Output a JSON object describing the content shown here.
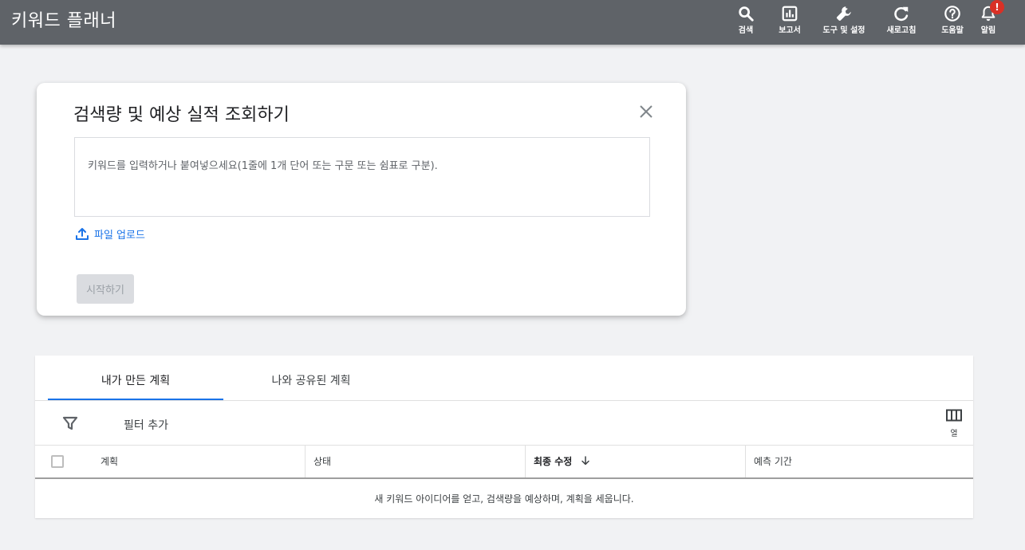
{
  "topbar": {
    "title": "키워드 플래너",
    "buttons": [
      {
        "label": "검색",
        "icon": "search-icon"
      },
      {
        "label": "보고서",
        "icon": "reports-icon"
      },
      {
        "label": "도구 및 설정",
        "icon": "wrench-icon"
      },
      {
        "label": "새로고침",
        "icon": "refresh-icon"
      },
      {
        "label": "도움말",
        "icon": "help-icon"
      },
      {
        "label": "알림",
        "icon": "bell-icon",
        "badge": "!"
      }
    ],
    "bar_color": "#5f6368"
  },
  "card": {
    "title": "검색량 및 예상 실적 조회하기",
    "input_placeholder": "키워드를 입력하거나 붙여넣으세요(1줄에 1개 단어 또는 구문 또는 쉼표로 구분).",
    "upload_label": "파일 업로드",
    "start_label": "시작하기"
  },
  "plans": {
    "tabs": [
      {
        "label": "내가 만든 계획",
        "active": true
      },
      {
        "label": "나와 공유된 계획",
        "active": false
      }
    ],
    "filter_label": "필터 추가",
    "columns_label": "열",
    "headers": [
      "계획",
      "상태",
      "최종 수정",
      "예측 기간"
    ],
    "sorted_column": "최종 수정",
    "empty_message": "새 키워드 아이디어를 얻고, 검색량을 예상하며, 계획을 세웁니다."
  },
  "colors": {
    "accent": "#1a73e8",
    "badge": "#d93025"
  }
}
